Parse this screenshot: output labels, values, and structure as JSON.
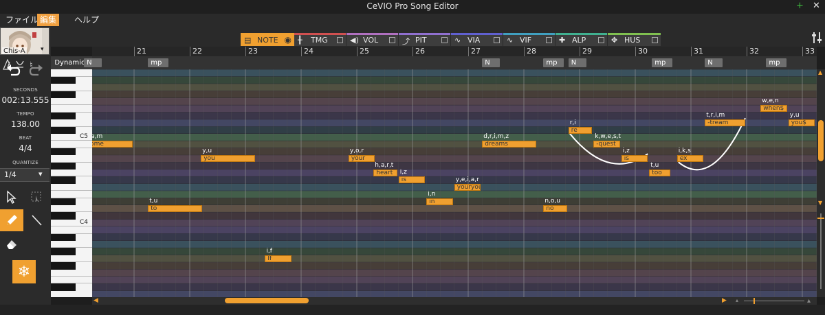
{
  "window": {
    "title": "CeVIO Pro Song Editor",
    "add_icon": "+",
    "close_icon": "✕"
  },
  "menu": {
    "items": [
      "ファイル",
      "編集",
      "ヘルプ"
    ],
    "active_index": 1
  },
  "singer": {
    "name": "Chis-A"
  },
  "info": {
    "seconds_label": "SECONDS",
    "seconds_value": "002:13.555",
    "tempo_label": "TEMPO",
    "tempo_value": "138.00",
    "beat_label": "BEAT",
    "beat_value": "4/4",
    "quantize_label": "QUANTIZE",
    "quantize_value": "1/4"
  },
  "tabs": [
    {
      "label": "NOTE",
      "color": "#f0a030",
      "active": true
    },
    {
      "label": "TMG",
      "color": "#d05050",
      "active": false
    },
    {
      "label": "VOL",
      "color": "#b070c0",
      "active": false
    },
    {
      "label": "PIT",
      "color": "#9070d0",
      "active": false
    },
    {
      "label": "VIA",
      "color": "#6060d0",
      "active": false
    },
    {
      "label": "VIF",
      "color": "#40a0c0",
      "active": false
    },
    {
      "label": "ALP",
      "color": "#40b090",
      "active": false
    },
    {
      "label": "HUS",
      "color": "#80c050",
      "active": false
    }
  ],
  "ruler": {
    "bars": [
      "21",
      "22",
      "23",
      "24",
      "25",
      "26",
      "27",
      "28",
      "29",
      "30",
      "31",
      "32",
      "33"
    ]
  },
  "dynamics": {
    "label": "Dynamics",
    "marks": [
      {
        "text": "N",
        "bar": 20.1
      },
      {
        "text": "mp",
        "bar": 21.25
      },
      {
        "text": "N",
        "bar": 27.25
      },
      {
        "text": "mp",
        "bar": 28.35
      },
      {
        "text": "N",
        "bar": 28.8
      },
      {
        "text": "mp",
        "bar": 30.3
      },
      {
        "text": "N",
        "bar": 31.25
      },
      {
        "text": "mp",
        "bar": 32.35
      }
    ]
  },
  "keyboard": {
    "c5_label": "C5",
    "c4_label": "C4"
  },
  "notes": [
    {
      "lyric": "come",
      "phonemes": "k,a,m",
      "start": 20.1,
      "dur": 0.9,
      "pitch": 71
    },
    {
      "lyric": "to",
      "phonemes": "t,u",
      "start": 21.25,
      "dur": 1.0,
      "pitch": 62
    },
    {
      "lyric": "you",
      "phonemes": "y,u",
      "start": 22.2,
      "dur": 1.0,
      "pitch": 69
    },
    {
      "lyric": "If",
      "phonemes": "i,f",
      "start": 23.35,
      "dur": 0.5,
      "pitch": 55
    },
    {
      "lyric": "your",
      "phonemes": "y,o,r",
      "start": 24.85,
      "dur": 0.5,
      "pitch": 69
    },
    {
      "lyric": "heart",
      "phonemes": "h,a,r,t",
      "start": 25.3,
      "dur": 0.45,
      "pitch": 67
    },
    {
      "lyric": "is",
      "phonemes": "i,z",
      "start": 25.75,
      "dur": 0.5,
      "pitch": 66
    },
    {
      "lyric": "in",
      "phonemes": "i,n",
      "start": 26.25,
      "dur": 0.5,
      "pitch": 63
    },
    {
      "lyric": "youryour",
      "phonemes": "y,e,i,a,r",
      "start": 26.75,
      "dur": 0.5,
      "pitch": 65
    },
    {
      "lyric": "dreams",
      "phonemes": "d,r,i,m,z",
      "start": 27.25,
      "dur": 1.0,
      "pitch": 71
    },
    {
      "lyric": "no",
      "phonemes": "n,o,u",
      "start": 28.35,
      "dur": 0.45,
      "pitch": 62
    },
    {
      "lyric": "re",
      "phonemes": "r,i",
      "start": 28.8,
      "dur": 0.45,
      "pitch": 73
    },
    {
      "lyric": "-quest",
      "phonemes": "k,w,e,s,t",
      "start": 29.25,
      "dur": 0.5,
      "pitch": 71
    },
    {
      "lyric": "is",
      "phonemes": "i,z",
      "start": 29.75,
      "dur": 0.5,
      "pitch": 69
    },
    {
      "lyric": "too",
      "phonemes": "t,u",
      "start": 30.25,
      "dur": 0.4,
      "pitch": 67
    },
    {
      "lyric": "ex",
      "phonemes": "i,k,s",
      "start": 30.75,
      "dur": 0.5,
      "pitch": 69
    },
    {
      "lyric": "-tream",
      "phonemes": "t,r,i,m",
      "start": 31.25,
      "dur": 0.75,
      "pitch": 74
    },
    {
      "lyric": "when$",
      "phonemes": "w,e,n",
      "start": 32.25,
      "dur": 0.5,
      "pitch": 76
    },
    {
      "lyric": "you$",
      "phonemes": "y,u",
      "start": 32.75,
      "dur": 0.5,
      "pitch": 74
    },
    {
      "lyric": "",
      "phonemes": "",
      "start": 20.0,
      "dur": 0.1,
      "pitch": 61
    }
  ],
  "slurs": [
    {
      "from_note": 11,
      "to_note": 13
    },
    {
      "from_note": 15,
      "to_note": 16
    }
  ]
}
